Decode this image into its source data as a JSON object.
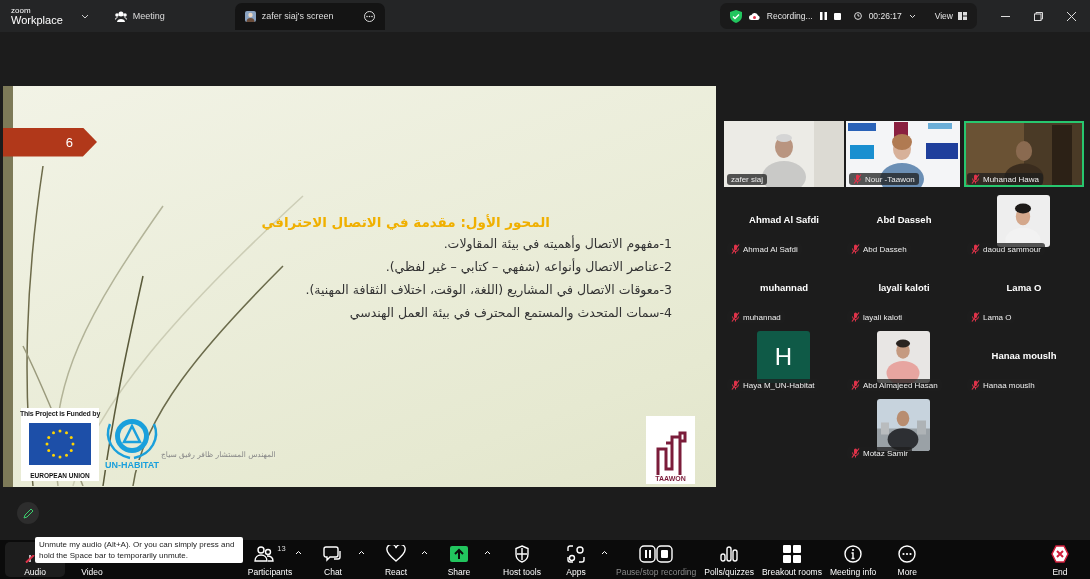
{
  "title_bar": {
    "logo_top": "zoom",
    "logo_bottom": "Workplace",
    "tabs": [
      {
        "label": "Meeting",
        "kind": "meeting",
        "selected": false
      },
      {
        "label": "zafer siaj's screen",
        "kind": "share",
        "selected": true
      }
    ],
    "recording": {
      "label": "Recording...",
      "timer": "00:26:17"
    },
    "view": "View"
  },
  "slide": {
    "number": "6",
    "heading": "المحور الأول: مقدمة في الاتصال الاحترافي",
    "points": [
      "1-مفهوم الاتصال وأهميته في بيئة المقاولات.",
      "2-عناصر الاتصال وأنواعه (شفهي – كتابي – غير لفظي).",
      "3-معوقات الاتصال في المشاريع (اللغة، الوقت، اختلاف الثقافة المهنية).",
      "4-سمات المتحدث والمستمع المحترف في بيئة العمل الهندسي"
    ],
    "funded_by": "This Project is Funded by",
    "eu": "EUROPEAN UNION",
    "un_habitat": "UN-HABITAT",
    "author": "المهندس المستشار ظافر رفيق سياج",
    "taawon": "TAAWON"
  },
  "speakers": [
    {
      "name": "zafer siaj",
      "muted": false,
      "speaking": false
    },
    {
      "name": "Nour -Taawon",
      "muted": true,
      "speaking": false
    },
    {
      "name": "Muhanad Hawa",
      "muted": true,
      "speaking": true
    }
  ],
  "gallery": [
    {
      "kind": "name",
      "display": "Ahmad Al Safdi",
      "name": "Ahmad Al Safdi",
      "muted": true
    },
    {
      "kind": "name",
      "display": "Abd Dasseh",
      "name": "Abd Dasseh",
      "muted": true
    },
    {
      "name": "daoud sammour",
      "muted": true
    },
    {
      "kind": "name",
      "display": "muhannad",
      "name": "muhannad",
      "muted": true
    },
    {
      "kind": "name",
      "display": "layali kaloti",
      "name": "layali kaloti",
      "muted": true
    },
    {
      "kind": "name",
      "display": "Lama O",
      "name": "Lama O",
      "muted": true
    },
    {
      "kind": "initial",
      "initial": "H",
      "name": "Haya M_UN-Habitat",
      "muted": true
    },
    {
      "name": "Abd Almajeed Hasan",
      "muted": true
    },
    {
      "kind": "name",
      "display": "Hanaa mouslh",
      "name": "Hanaa mouslh",
      "muted": true
    },
    {
      "name": "Motaz Samir",
      "muted": true
    }
  ],
  "toolbar": [
    {
      "kind": "audio",
      "label": "Audio",
      "muted": true,
      "menu": false,
      "disabled": false
    },
    {
      "kind": "video",
      "label": "Video",
      "menu": false,
      "disabled": false
    },
    {
      "kind": "participants",
      "label": "Participants",
      "count": "13",
      "menu": true,
      "disabled": false
    },
    {
      "kind": "chat",
      "label": "Chat",
      "menu": true,
      "disabled": false
    },
    {
      "kind": "react",
      "label": "React",
      "menu": true,
      "disabled": false
    },
    {
      "kind": "share",
      "label": "Share",
      "menu": true,
      "disabled": false
    },
    {
      "kind": "host",
      "label": "Host tools",
      "menu": false,
      "disabled": false
    },
    {
      "kind": "apps",
      "label": "Apps",
      "menu": true,
      "disabled": false
    },
    {
      "kind": "recording",
      "label": "Pause/stop recording",
      "menu": false,
      "disabled": true
    },
    {
      "kind": "polls",
      "label": "Polls/quizzes",
      "menu": false,
      "disabled": false
    },
    {
      "kind": "breakout",
      "label": "Breakout rooms",
      "menu": false,
      "disabled": false
    },
    {
      "kind": "info",
      "label": "Meeting info",
      "menu": false,
      "disabled": false
    },
    {
      "kind": "more",
      "label": "More",
      "menu": false,
      "disabled": false
    },
    {
      "kind": "end",
      "label": "End",
      "menu": false,
      "disabled": false
    }
  ],
  "tooltip": "Unmute my audio (Alt+A). Or you can simply press and hold the Space bar to temporarily unmute."
}
